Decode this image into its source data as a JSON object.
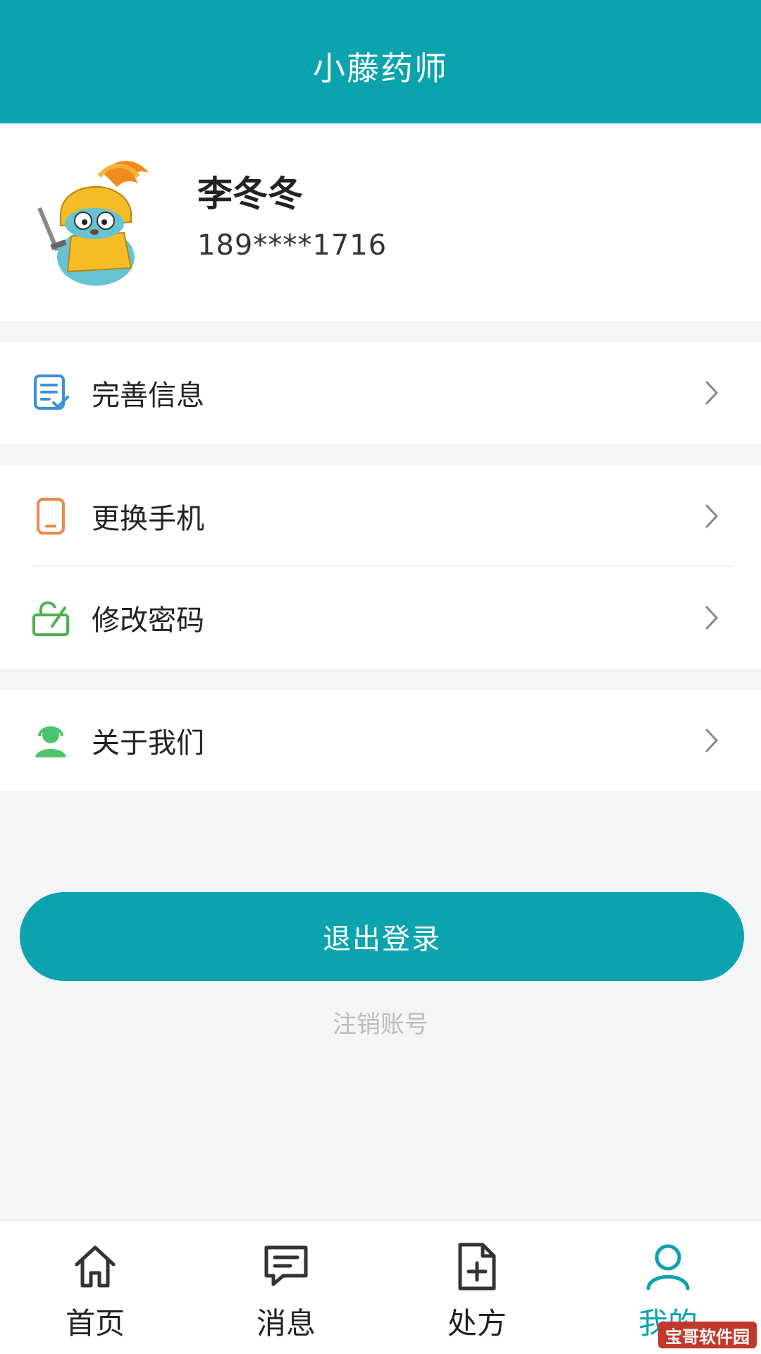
{
  "header": {
    "title": "小藤药师"
  },
  "profile": {
    "avatar_icon": "knight-gopher-avatar",
    "name": "李冬冬",
    "phone": "189****1716"
  },
  "menu": {
    "complete_info": {
      "label": "完善信息",
      "icon": "document-check-icon",
      "color": "#3d8fd6"
    },
    "change_phone": {
      "label": "更换手机",
      "icon": "phone-icon",
      "color": "#e8894d"
    },
    "change_password": {
      "label": "修改密码",
      "icon": "lock-open-icon",
      "color": "#4caf50"
    },
    "about_us": {
      "label": "关于我们",
      "icon": "headset-user-icon",
      "color": "#4cc46b"
    }
  },
  "actions": {
    "logout_label": "退出登录",
    "cancel_account_label": "注销账号"
  },
  "tabbar": {
    "tabs": [
      {
        "label": "首页",
        "icon": "home-icon",
        "active": false
      },
      {
        "label": "消息",
        "icon": "message-icon",
        "active": false
      },
      {
        "label": "处方",
        "icon": "prescription-add-icon",
        "active": false
      },
      {
        "label": "我的",
        "icon": "user-icon",
        "active": true
      }
    ]
  },
  "watermark": {
    "text": "宝哥软件园"
  },
  "colors": {
    "brand": "#0aa3ae",
    "background": "#f4f5f7"
  }
}
